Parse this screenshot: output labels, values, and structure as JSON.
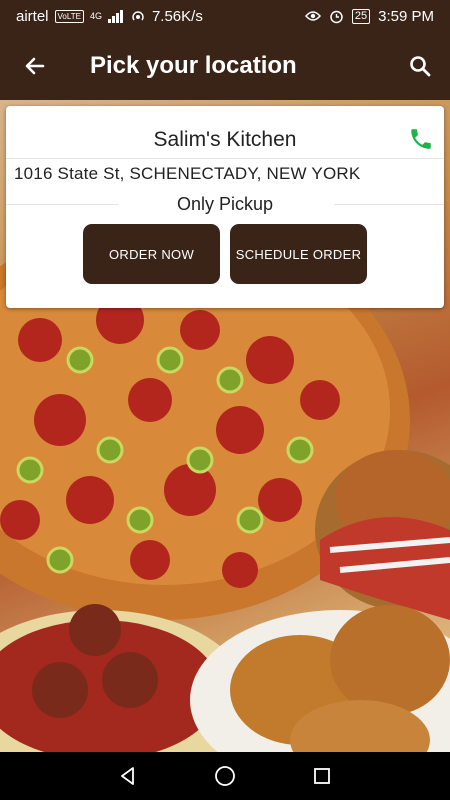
{
  "status_bar": {
    "carrier": "airtel",
    "volte": "VoLTE",
    "network": "4G",
    "speed": "7.56K/s",
    "battery": "25",
    "time": "3:59 PM"
  },
  "toolbar": {
    "title": "Pick your location",
    "back_icon": "arrow-left-icon",
    "search_icon": "search-icon"
  },
  "restaurant": {
    "name": "Salim's Kitchen",
    "address": "1016 State St, SCHENECTADY, NEW YORK",
    "mode": "Only Pickup",
    "phone_icon": "phone-icon"
  },
  "actions": {
    "order_now": "ORDER NOW",
    "schedule_order": "SCHEDULE ORDER"
  },
  "colors": {
    "brand": "#3a2418",
    "phone": "#1bb34a"
  }
}
